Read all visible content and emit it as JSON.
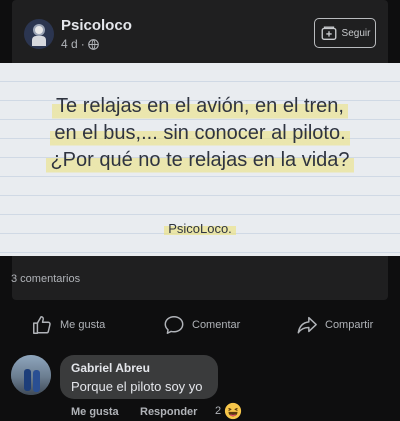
{
  "post": {
    "page_name": "Psicoloco",
    "time": "4 d",
    "separator": "·",
    "follow_label": "Seguir",
    "image_text": {
      "lines": [
        "Te relajas en el avión, en el tren,",
        "en el bus,... sin conocer al piloto.",
        "¿Por qué no te relajas en la vida?"
      ],
      "signature": "PsicoLoco."
    },
    "comments_count": "3 comentarios",
    "actions": {
      "like": "Me gusta",
      "comment": "Comentar",
      "share": "Compartir"
    }
  },
  "comment": {
    "author": "Gabriel Abreu",
    "text": "Porque el piloto soy yo",
    "like_label": "Me gusta",
    "reply_label": "Responder",
    "reaction_count": "2"
  },
  "colors": {
    "background": "#0e0e0f",
    "card": "#1f1f20",
    "bubble": "#3a3b3c",
    "highlight": "#ece278"
  }
}
